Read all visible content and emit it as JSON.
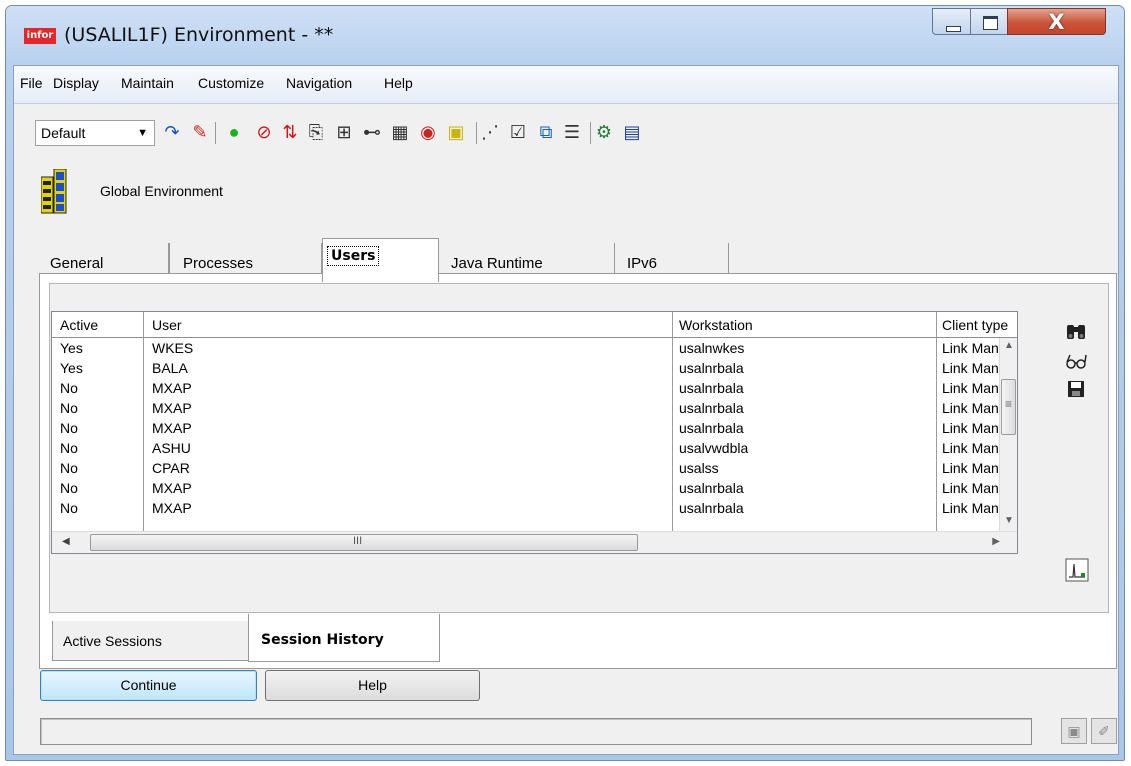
{
  "window": {
    "app_icon_text": "infor",
    "title": "(USALIL1F) Environment - **",
    "close_glyph": "X"
  },
  "menu": [
    "File",
    "Display",
    "Maintain",
    "Customize",
    "Navigation",
    "Help"
  ],
  "toolbar": {
    "view_select": "Default",
    "icons": [
      {
        "name": "refresh-icon",
        "glyph": "↷",
        "color": "#1a4fc9"
      },
      {
        "name": "edit-pencil-icon",
        "glyph": "✎",
        "color": "#c2291c"
      },
      {
        "name": "start-green-icon",
        "glyph": "●",
        "color": "#19b419"
      },
      {
        "name": "stop-red-icon",
        "glyph": "⊘",
        "color": "#d1141a"
      },
      {
        "name": "transfer-arrows-icon",
        "glyph": "⇅",
        "color": "#d1141a"
      },
      {
        "name": "copy-icon",
        "glyph": "⎘",
        "color": "#333333"
      },
      {
        "name": "tree-icon",
        "glyph": "⊞",
        "color": "#333333"
      },
      {
        "name": "a1-b3-icon",
        "glyph": "⊷",
        "color": "#333333"
      },
      {
        "name": "document-bullets-icon",
        "glyph": "▦",
        "color": "#333333"
      },
      {
        "name": "red-circle-delete-icon",
        "glyph": "◉",
        "color": "#cc2222"
      },
      {
        "name": "info-yellow-icon",
        "glyph": "▣",
        "color": "#c9b400"
      },
      {
        "name": "network-icon",
        "glyph": "⋰",
        "color": "#333333"
      },
      {
        "name": "checklist-icon",
        "glyph": "☑",
        "color": "#333333"
      },
      {
        "name": "windows-icon",
        "glyph": "⧉",
        "color": "#1b5fb5"
      },
      {
        "name": "list-icon",
        "glyph": "☰",
        "color": "#333333"
      },
      {
        "name": "tools-icon",
        "glyph": "⚙",
        "color": "#2a7a3a"
      },
      {
        "name": "grid-chart-icon",
        "glyph": "▤",
        "color": "#1b3f9c"
      }
    ]
  },
  "environment": {
    "label": "Global Environment"
  },
  "tabs": [
    {
      "label": "General"
    },
    {
      "label": "Processes"
    },
    {
      "label": "Users",
      "active": true
    },
    {
      "label": "Java Runtime"
    },
    {
      "label": "IPv6"
    }
  ],
  "grid": {
    "columns": [
      "Active",
      "User",
      "Workstation",
      "Client type"
    ],
    "rows": [
      [
        "Yes",
        "WKES",
        "usalnwkes",
        "Link Mana"
      ],
      [
        "Yes",
        "BALA",
        "usalnrbala",
        "Link Mana"
      ],
      [
        "No",
        "MXAP",
        "usalnrbala",
        "Link Mana"
      ],
      [
        "No",
        "MXAP",
        "usalnrbala",
        "Link Mana"
      ],
      [
        "No",
        "MXAP",
        "usalnrbala",
        "Link Mana"
      ],
      [
        "No",
        "ASHU",
        "usalvwdbla",
        "Link Mana"
      ],
      [
        "No",
        "CPAR",
        "usalss",
        "Link Mana"
      ],
      [
        "No",
        "MXAP",
        "usalnrbala",
        "Link Mana"
      ],
      [
        "No",
        "MXAP",
        "usalnrbala",
        "Link Mana"
      ]
    ],
    "hscroll_grip": "III"
  },
  "side_icons": [
    "binoculars-icon",
    "glasses-icon",
    "save-icon"
  ],
  "subtabs": [
    {
      "label": "Active Sessions"
    },
    {
      "label": "Session History",
      "active": true
    }
  ],
  "buttons": {
    "continue": "Continue",
    "help": "Help"
  },
  "status": {
    "text": ""
  }
}
